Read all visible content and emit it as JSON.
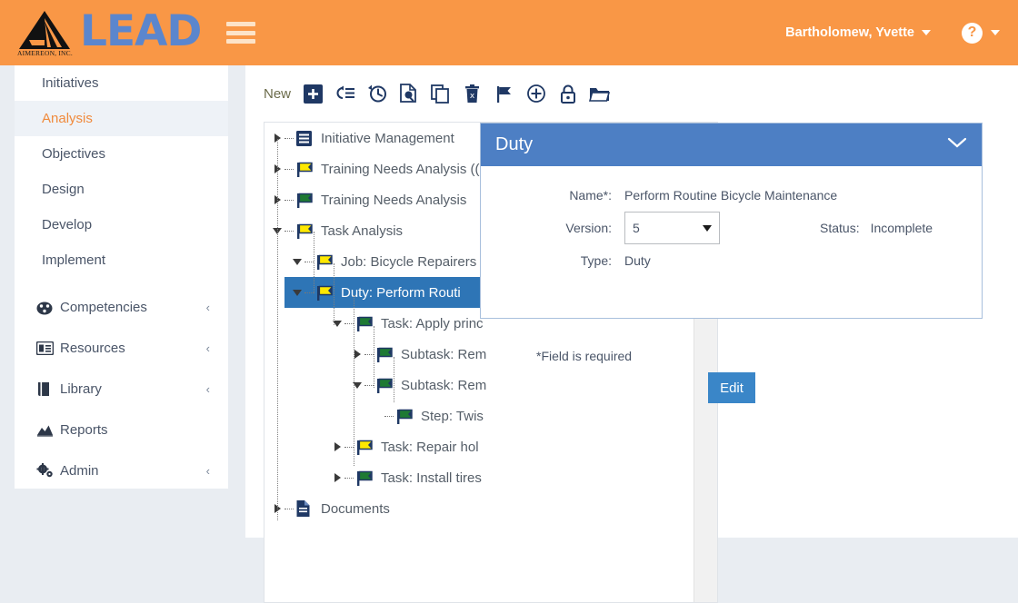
{
  "brand": {
    "logo_word": "LEAD",
    "company": "AIMEREON, INC.",
    "menu_icon": "hamburger-icon"
  },
  "topbar": {
    "user_name": "Bartholomew, Yvette",
    "help_glyph": "?",
    "bg_color": "#f99746"
  },
  "sidebar": {
    "items": [
      {
        "label": "Initiatives",
        "type": "link",
        "active": false
      },
      {
        "label": "Analysis",
        "type": "link",
        "active": true
      },
      {
        "label": "Objectives",
        "type": "link",
        "active": false
      },
      {
        "label": "Design",
        "type": "link",
        "active": false
      },
      {
        "label": "Develop",
        "type": "link",
        "active": false
      },
      {
        "label": "Implement",
        "type": "link",
        "active": false
      }
    ],
    "groups": [
      {
        "label": "Competencies",
        "icon": "competencies-icon",
        "chevron": "‹"
      },
      {
        "label": "Resources",
        "icon": "resources-icon",
        "chevron": "‹"
      },
      {
        "label": "Library",
        "icon": "library-icon",
        "chevron": "‹"
      },
      {
        "label": "Reports",
        "icon": "reports-icon",
        "chevron": ""
      },
      {
        "label": "Admin",
        "icon": "admin-gears-icon",
        "chevron": "‹"
      }
    ]
  },
  "toolbar": {
    "new_label": "New",
    "buttons": [
      {
        "name": "new-add-button",
        "icon": "plus-square-icon"
      },
      {
        "name": "move-button",
        "icon": "arrow-list-icon"
      },
      {
        "name": "history-button",
        "icon": "clock-history-icon"
      },
      {
        "name": "preview-button",
        "icon": "document-search-icon"
      },
      {
        "name": "copy-button",
        "icon": "copy-icon"
      },
      {
        "name": "delete-button",
        "icon": "trash-icon"
      },
      {
        "name": "flag-button",
        "icon": "flag-icon"
      },
      {
        "name": "add-circle-button",
        "icon": "plus-circle-icon"
      },
      {
        "name": "lock-button",
        "icon": "lock-icon"
      },
      {
        "name": "folder-button",
        "icon": "folder-icon"
      }
    ]
  },
  "tree": {
    "nodes": [
      {
        "label": "Initiative Management",
        "icon": "initiative-icon",
        "icon_color": "#1f3864",
        "depth": 0,
        "state": "collapsed",
        "selected": false
      },
      {
        "label": "Training Needs Analysis ((",
        "icon": "flag-icon",
        "icon_color": "#ffe800",
        "depth": 0,
        "state": "collapsed",
        "selected": false
      },
      {
        "label": "Training Needs Analysis",
        "icon": "flag-icon",
        "icon_color": "#1e7a33",
        "depth": 0,
        "state": "collapsed",
        "selected": false
      },
      {
        "label": "Task Analysis",
        "icon": "flag-icon",
        "icon_color": "#ffe800",
        "depth": 0,
        "state": "expanded",
        "selected": false
      },
      {
        "label": "Job: Bicycle Repairers",
        "icon": "flag-icon",
        "icon_color": "#ffe800",
        "depth": 1,
        "state": "expanded",
        "selected": false
      },
      {
        "label": "Duty: Perform Routi",
        "icon": "flag-icon",
        "icon_color": "#ffe800",
        "depth": 2,
        "state": "expanded",
        "selected": true
      },
      {
        "label": "Task: Apply princ",
        "icon": "flag-icon",
        "icon_color": "#1e7a33",
        "depth": 3,
        "state": "expanded",
        "selected": false
      },
      {
        "label": "Subtask: Rem",
        "icon": "flag-icon",
        "icon_color": "#1e7a33",
        "depth": 4,
        "state": "collapsed",
        "selected": false
      },
      {
        "label": "Subtask: Rem",
        "icon": "flag-icon",
        "icon_color": "#1e7a33",
        "depth": 4,
        "state": "expanded",
        "selected": false
      },
      {
        "label": "Step: Twis",
        "icon": "flag-icon",
        "icon_color": "#1e7a33",
        "depth": 5,
        "state": "leaf",
        "selected": false
      },
      {
        "label": "Task: Repair hol",
        "icon": "flag-icon",
        "icon_color": "#ffe800",
        "depth": 3,
        "state": "collapsed",
        "selected": false
      },
      {
        "label": "Task: Install tires",
        "icon": "flag-icon",
        "icon_color": "#1e7a33",
        "depth": 3,
        "state": "collapsed",
        "selected": false
      },
      {
        "label": "Documents",
        "icon": "document-icon",
        "icon_color": "#1f3864",
        "depth": 0,
        "state": "collapsed",
        "selected": false
      }
    ],
    "scrollbar": {
      "name": "tree-scrollbar",
      "up_arrow": "scroll-up-arrow-icon"
    }
  },
  "detail": {
    "title": "Duty",
    "collapse_icon": "chevron-down-icon",
    "header_color": "#4d7fc4",
    "fields": {
      "name_label": "Name*:",
      "name_value": "Perform Routine Bicycle Maintenance",
      "version_label": "Version:",
      "version_value": "5",
      "status_label": "Status:",
      "status_value": "Incomplete",
      "type_label": "Type:",
      "type_value": "Duty"
    },
    "required_note": "*Field is required",
    "edit_button": "Edit",
    "edit_button_color": "#3a86c8"
  }
}
